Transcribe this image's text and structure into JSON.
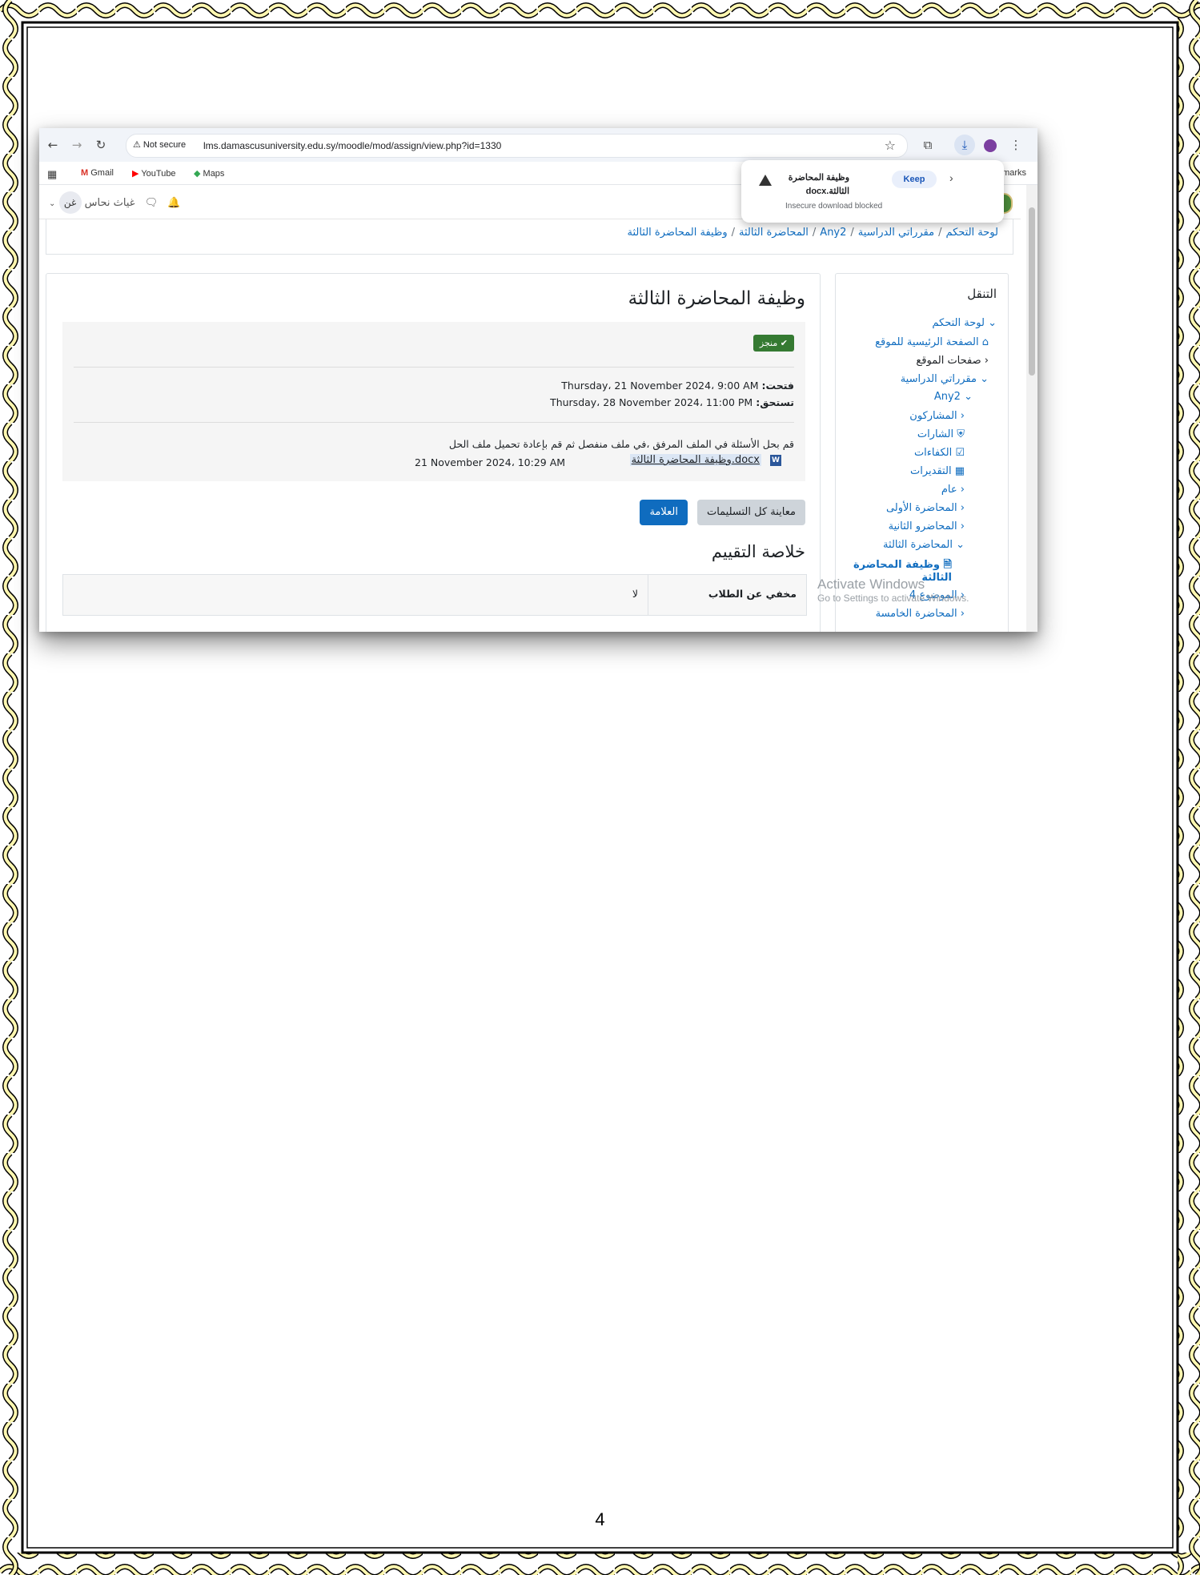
{
  "browser": {
    "security_label": "Not secure",
    "url": "lms.damascusuniversity.edu.sy/moodle/mod/assign/view.php?id=1330",
    "bookmarks": [
      "Gmail",
      "YouTube",
      "Maps"
    ],
    "bookmarks_overflow": "Bookmarks"
  },
  "download_popup": {
    "file_name": "وظيفة المحاضرة الثالثة.docx",
    "status": "Insecure download blocked",
    "keep_label": "Keep"
  },
  "header": {
    "user_name": "غياث نحاس",
    "user_initials": "غن"
  },
  "breadcrumb": [
    "لوحة التحكم",
    "مقرراتي الدراسية",
    "Any2",
    "المحاضرة الثالثة",
    "وظيفة المحاضرة الثالثة"
  ],
  "assignment": {
    "title": "وظيفة المحاضرة الثالثة",
    "status_badge": "منجز",
    "opened_label": "فتحت:",
    "opened_value": "Thursday، 21 November 2024، 9:00 AM",
    "due_label": "تستحق:",
    "due_value": "Thursday، 28 November 2024، 11:00 PM",
    "instructions": "قم بحل الأسئلة في الملف المرفق ،في ملف منفصل ثم قم بإعادة تحميل ملف الحل",
    "file_link": "وظيفة المحاضرة الثالثة.docx",
    "file_date": "21 November 2024، 10:29 AM",
    "view_all_button": "معاينة كل التسليمات",
    "grade_button": "العلامة",
    "summary_heading": "خلاصة التقييم",
    "table": {
      "header": "مخفي عن الطلاب",
      "value": "لا"
    }
  },
  "sidebar": {
    "heading": "التنقل",
    "items": [
      "لوحة التحكم",
      "الصفحة الرئيسية للموقع",
      "صفحات الموقع",
      "مقرراتي الدراسية",
      "Any2",
      "المشاركون",
      "الشارات",
      "الكفاءات",
      "التقديرات",
      "عام",
      "المحاضرة الأولى",
      "المحاضرو الثانية",
      "المحاضرة الثالثة",
      "وظيفة المحاضرة",
      "الثالثة",
      "الموضوع 4",
      "المحاضرة الخامسة"
    ]
  },
  "watermark": {
    "line1": "Activate Windows",
    "line2": "Go to Settings to activate Windows."
  },
  "page_number": "4",
  "colors": {
    "frame_wave": "#fff7b0",
    "frame_line": "#000000",
    "link": "#0f6cbf",
    "badge": "#357a32",
    "primary": "#0f6cbf"
  }
}
